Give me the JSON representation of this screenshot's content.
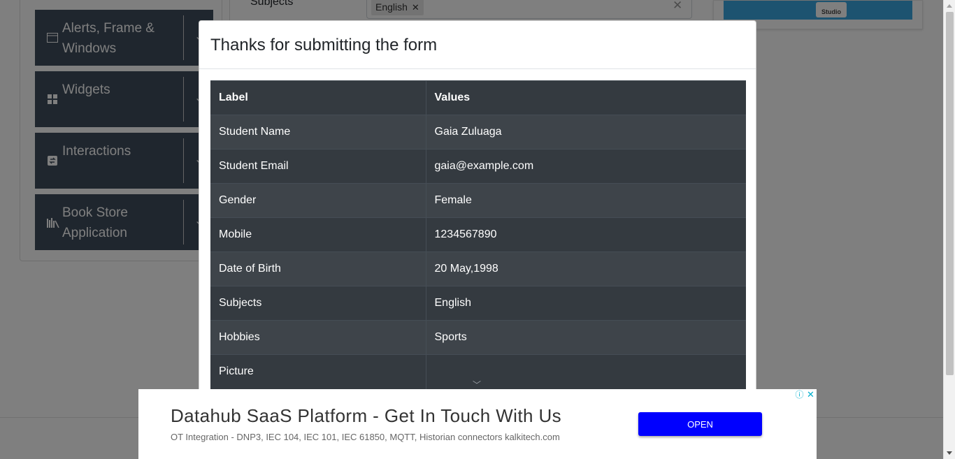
{
  "sidebar": {
    "groups": [
      {
        "label": "Alerts, Frame & Windows",
        "icon": "window-icon"
      },
      {
        "label": "Widgets",
        "icon": "widgets-icon"
      },
      {
        "label": "Interactions",
        "icon": "interactions-icon"
      },
      {
        "label": "Book Store Application",
        "icon": "bookshelf-icon"
      }
    ]
  },
  "form": {
    "subjects_label": "Subjects",
    "subject_chip": "English"
  },
  "side_ad": {
    "badge": "Studio"
  },
  "modal": {
    "title": "Thanks for submitting the form",
    "table": {
      "headers": [
        "Label",
        "Values"
      ],
      "rows": [
        {
          "label": "Student Name",
          "value": "Gaia Zuluaga"
        },
        {
          "label": "Student Email",
          "value": "gaia@example.com"
        },
        {
          "label": "Gender",
          "value": "Female"
        },
        {
          "label": "Mobile",
          "value": "1234567890"
        },
        {
          "label": "Date of Birth",
          "value": "20 May,1998"
        },
        {
          "label": "Subjects",
          "value": "English"
        },
        {
          "label": "Hobbies",
          "value": "Sports"
        },
        {
          "label": "Picture",
          "value": ""
        }
      ]
    }
  },
  "ad_banner": {
    "title": "Datahub SaaS Platform - Get In Touch With Us",
    "subtitle": "OT Integration - DNP3, IEC 104, IEC 101, IEC 61850, MQTT, Historian connectors kalkitech.com",
    "button": "OPEN",
    "button_color": "#0000ff"
  },
  "colors": {
    "table_dark": "#343a40",
    "table_striped": "#3e444a",
    "sidebar_group": "#3f4d5c",
    "ad_icon": "#00aecd"
  }
}
